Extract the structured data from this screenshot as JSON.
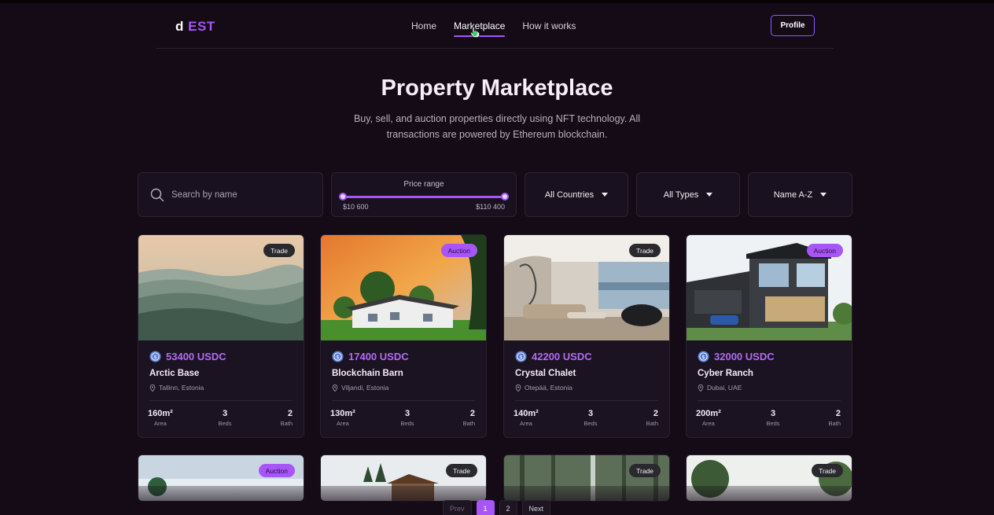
{
  "nav": {
    "logo_d": "d",
    "logo_est": "EST",
    "links": [
      "Home",
      "Marketplace",
      "How it works"
    ],
    "active": "Marketplace",
    "profile_label": "Profile"
  },
  "hero": {
    "title": "Property Marketplace",
    "subtitle": "Buy, sell, and auction properties directly using NFT technology. All transactions are powered by Ethereum blockchain."
  },
  "filters": {
    "search_placeholder": "Search by name",
    "price_label": "Price range",
    "price_min": "$10 600",
    "price_max": "$110 400",
    "country": "All Countries",
    "type": "All Types",
    "sort": "Name A-Z"
  },
  "colors": {
    "accent": "#a855f7",
    "background": "#140b17",
    "card": "#1c1322"
  },
  "cards": [
    {
      "badge": "Trade",
      "price": "53400 USDC",
      "name": "Arctic Base",
      "location": "Tallinn, Estonia",
      "area": "160m²",
      "beds": "3",
      "bath": "2",
      "area_label": "Area",
      "beds_label": "Beds",
      "bath_label": "Bath"
    },
    {
      "badge": "Auction",
      "price": "17400 USDC",
      "name": "Blockchain Barn",
      "location": "Viljandi, Estonia",
      "area": "130m²",
      "beds": "3",
      "bath": "2",
      "area_label": "Area",
      "beds_label": "Beds",
      "bath_label": "Bath"
    },
    {
      "badge": "Trade",
      "price": "42200 USDC",
      "name": "Crystal Chalet",
      "location": "Otepää, Estonia",
      "area": "140m²",
      "beds": "3",
      "bath": "2",
      "area_label": "Area",
      "beds_label": "Beds",
      "bath_label": "Bath"
    },
    {
      "badge": "Auction",
      "price": "32000 USDC",
      "name": "Cyber Ranch",
      "location": "Dubai, UAE",
      "area": "200m²",
      "beds": "3",
      "bath": "2",
      "area_label": "Area",
      "beds_label": "Beds",
      "bath_label": "Bath"
    }
  ],
  "cards_row2": [
    {
      "badge": "Auction"
    },
    {
      "badge": "Trade"
    },
    {
      "badge": "Trade"
    },
    {
      "badge": "Trade"
    }
  ],
  "pagination": {
    "prev": "Prev",
    "pages": [
      "1",
      "2"
    ],
    "current": "1",
    "next": "Next"
  },
  "icons": {
    "search": "search-icon",
    "location": "location-pin-icon",
    "coin": "usdc-coin-icon",
    "caret": "chevron-down-icon"
  }
}
